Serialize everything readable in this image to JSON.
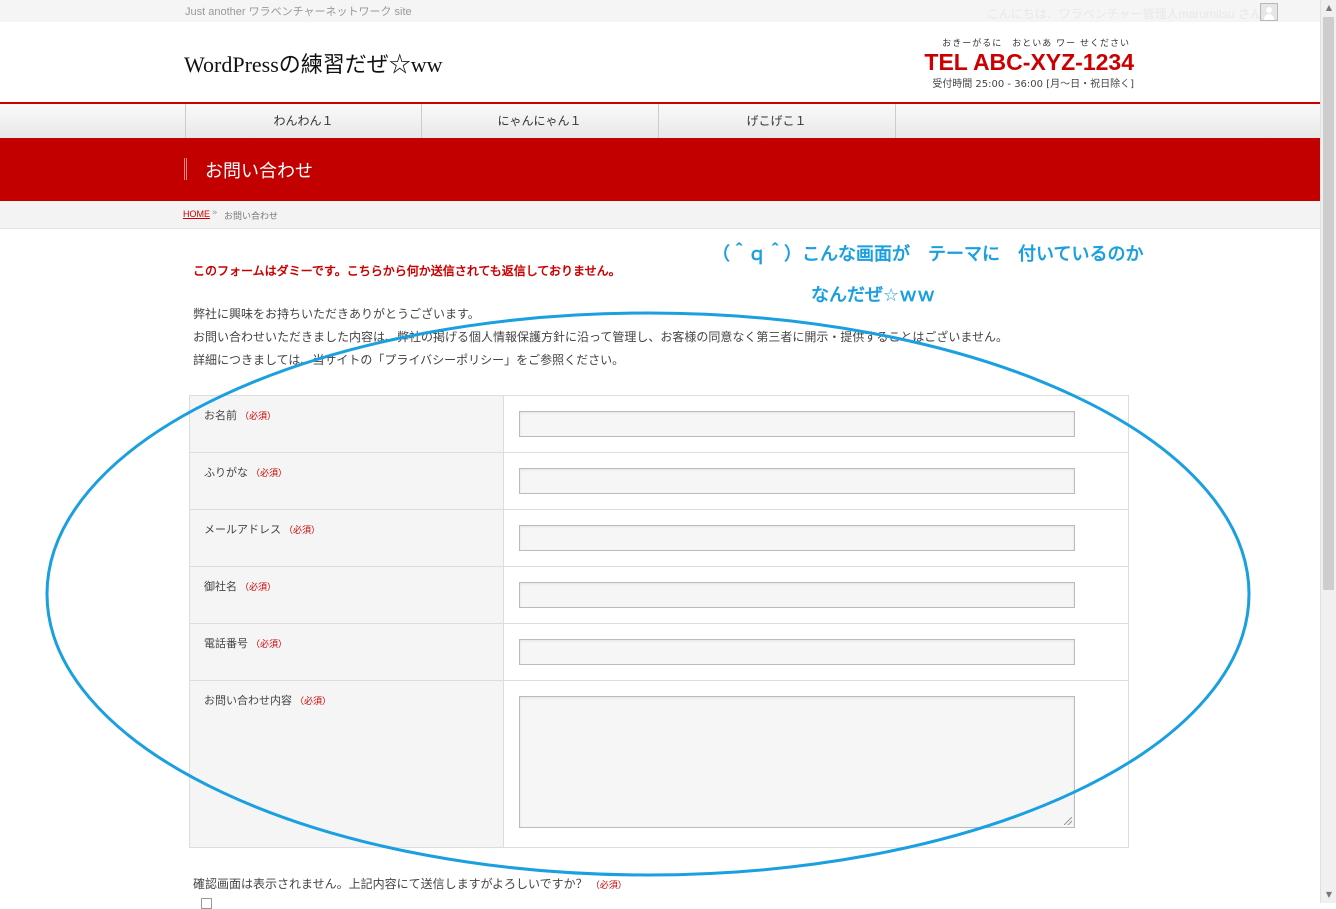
{
  "topbar": {
    "tagline": "Just another ワラベンチャーネットワーク site",
    "greeting": "こんにちは、ワラベンチャー管理人marumitsu さん"
  },
  "header": {
    "site_title": "WordPressの練習だぜ☆ww",
    "tel_kana": "おきーがるに　おといあ ワー せください",
    "tel_number": "TEL ABC-XYZ-1234",
    "tel_hours": "受付時間 25:00 - 36:00 [月〜日・祝日除く]"
  },
  "nav": {
    "items": [
      {
        "label": "わんわん１"
      },
      {
        "label": "にゃんにゃん１"
      },
      {
        "label": "げこげこ１"
      }
    ]
  },
  "page": {
    "title": "お問い合わせ"
  },
  "breadcrumb": {
    "home": "HOME",
    "separator": "»",
    "current": "お問い合わせ"
  },
  "content": {
    "notice": "このフォームはダミーです。こちらから何か送信されても返信しておりません。",
    "intro_lines": [
      "弊社に興味をお持ちいただきありがとうございます。",
      "お問い合わせいただきました内容は、弊社の掲げる個人情報保護方針に沿って管理し、お客様の同意なく第三者に開示・提供することはございません。",
      "詳細につきましては、当サイトの「プライバシーポリシー」をご参照ください。"
    ]
  },
  "form": {
    "required_tag": "（必須）",
    "fields": [
      {
        "label": "お名前"
      },
      {
        "label": "ふりがな"
      },
      {
        "label": "メールアドレス"
      },
      {
        "label": "御社名"
      },
      {
        "label": "電話番号"
      },
      {
        "label": "お問い合わせ内容"
      }
    ],
    "confirm_text": "確認画面は表示されません。上記内容にて送信しますがよろしいですか？"
  },
  "annotation": {
    "line1": "（＾ｑ＾）こんな画面が　テーマに　付いているのか",
    "line2": "なんだぜ☆ｗｗ",
    "color": "#1a9fe0"
  },
  "colors": {
    "brand_red": "#c30000",
    "link_red": "#cc0000"
  }
}
